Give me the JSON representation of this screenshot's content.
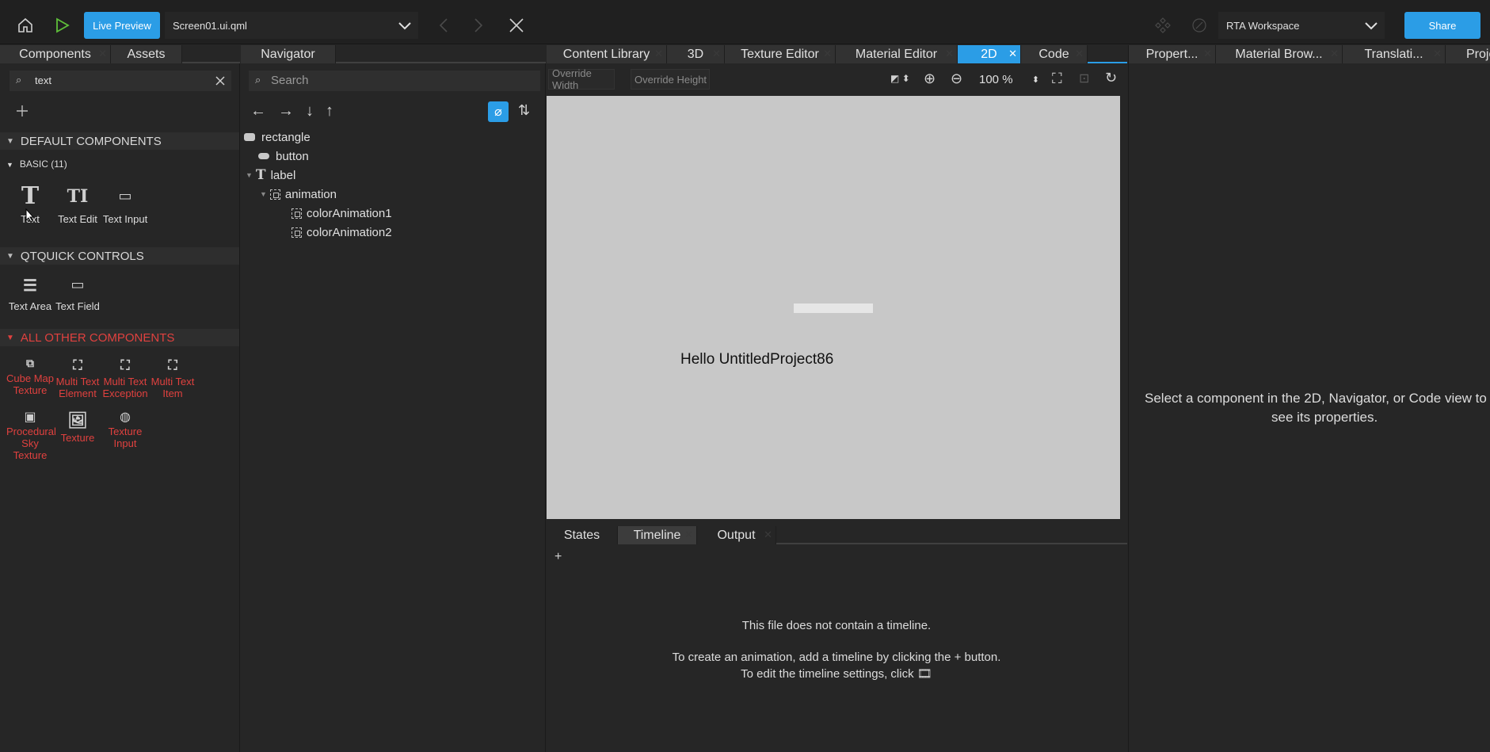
{
  "toolbar": {
    "live_preview": "Live Preview",
    "file_combo": "Screen01.ui.qml",
    "workspace_combo": "RTA Workspace",
    "share": "Share"
  },
  "left_panel": {
    "tabs": [
      "Components",
      "Assets"
    ],
    "search_value": "text",
    "sections": {
      "default": "DEFAULT COMPONENTS",
      "basic": "BASIC (11)",
      "qtquick": "QTQUICK CONTROLS",
      "other": "ALL OTHER COMPONENTS"
    },
    "basic_items": [
      "Text",
      "Text Edit",
      "Text Input"
    ],
    "qtquick_items": [
      "Text Area",
      "Text Field"
    ],
    "other_items": [
      "Cube Map Texture",
      "Multi Text Element",
      "Multi Text Exception",
      "Multi Text Item",
      "Procedural Sky Texture",
      "Texture",
      "Texture Input"
    ]
  },
  "navigator": {
    "tab": "Navigator",
    "search_placeholder": "Search",
    "tree": [
      "rectangle",
      "button",
      "label",
      "animation",
      "colorAnimation1",
      "colorAnimation2"
    ]
  },
  "center": {
    "tabs": [
      "Content Library",
      "3D",
      "Texture Editor",
      "Material Editor",
      "2D",
      "Code"
    ],
    "override_width": "Override Width",
    "override_height": "Override Height",
    "zoom": "100 %",
    "canvas_text": "Hello UntitledProject86"
  },
  "bottom": {
    "tabs": [
      "States",
      "Timeline",
      "Output"
    ],
    "add": "+",
    "msg1": "This file does not contain a timeline.",
    "msg2": "To create an animation, add a timeline by clicking the + button.",
    "msg3": "To edit the timeline settings, click 🎞"
  },
  "right_panel": {
    "tabs": [
      "Propert...",
      "Material Brow...",
      "Translati...",
      "Proje"
    ],
    "msg1": "Select a component in the 2D, Navigator, or Code view to",
    "msg2": "see its properties."
  },
  "colors": {
    "accent": "#2b9de6",
    "red_section": "#e0413f",
    "canvas": "#c8c8c8"
  }
}
